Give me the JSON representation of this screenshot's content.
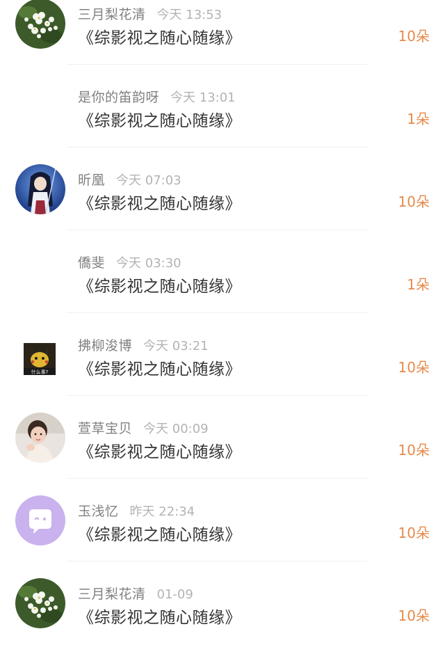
{
  "rows": [
    {
      "user": "三月梨花清",
      "time": "今天 13:53",
      "work": "《综影视之随心随缘》",
      "gift": "10朵",
      "avatar": "flower-avatar"
    },
    {
      "user": "是你的笛韵呀",
      "time": "今天 13:01",
      "work": "《综影视之随心随缘》",
      "gift": "1朵",
      "avatar": "none"
    },
    {
      "user": "昕凰",
      "time": "今天 07:03",
      "work": "《综影视之随心随缘》",
      "gift": "10朵",
      "avatar": "anime-girl-avatar"
    },
    {
      "user": "僑斐",
      "time": "今天 03:30",
      "work": "《综影视之随心随缘》",
      "gift": "1朵",
      "avatar": "none"
    },
    {
      "user": "拂柳浚博",
      "time": "今天 03:21",
      "work": "《综影视之随心随缘》",
      "gift": "10朵",
      "avatar": "pikachu-avatar"
    },
    {
      "user": "萱草宝贝",
      "time": "今天 00:09",
      "work": "《综影视之随心随缘》",
      "gift": "10朵",
      "avatar": "child-photo-avatar"
    },
    {
      "user": "玉浅忆",
      "time": "昨天 22:34",
      "work": "《综影视之随心随缘》",
      "gift": "10朵",
      "avatar": "chat-bubble-avatar"
    },
    {
      "user": "三月梨花清",
      "time": "01-09",
      "work": "《综影视之随心随缘》",
      "gift": "10朵",
      "avatar": "flower-avatar"
    }
  ],
  "avatar_texts": {
    "pikachu_caption": "什么事?"
  },
  "colors": {
    "username": "#808080",
    "time": "#b3b3b3",
    "title": "#333333",
    "gift": "#e68a4a",
    "divider": "#f0f0f0"
  }
}
